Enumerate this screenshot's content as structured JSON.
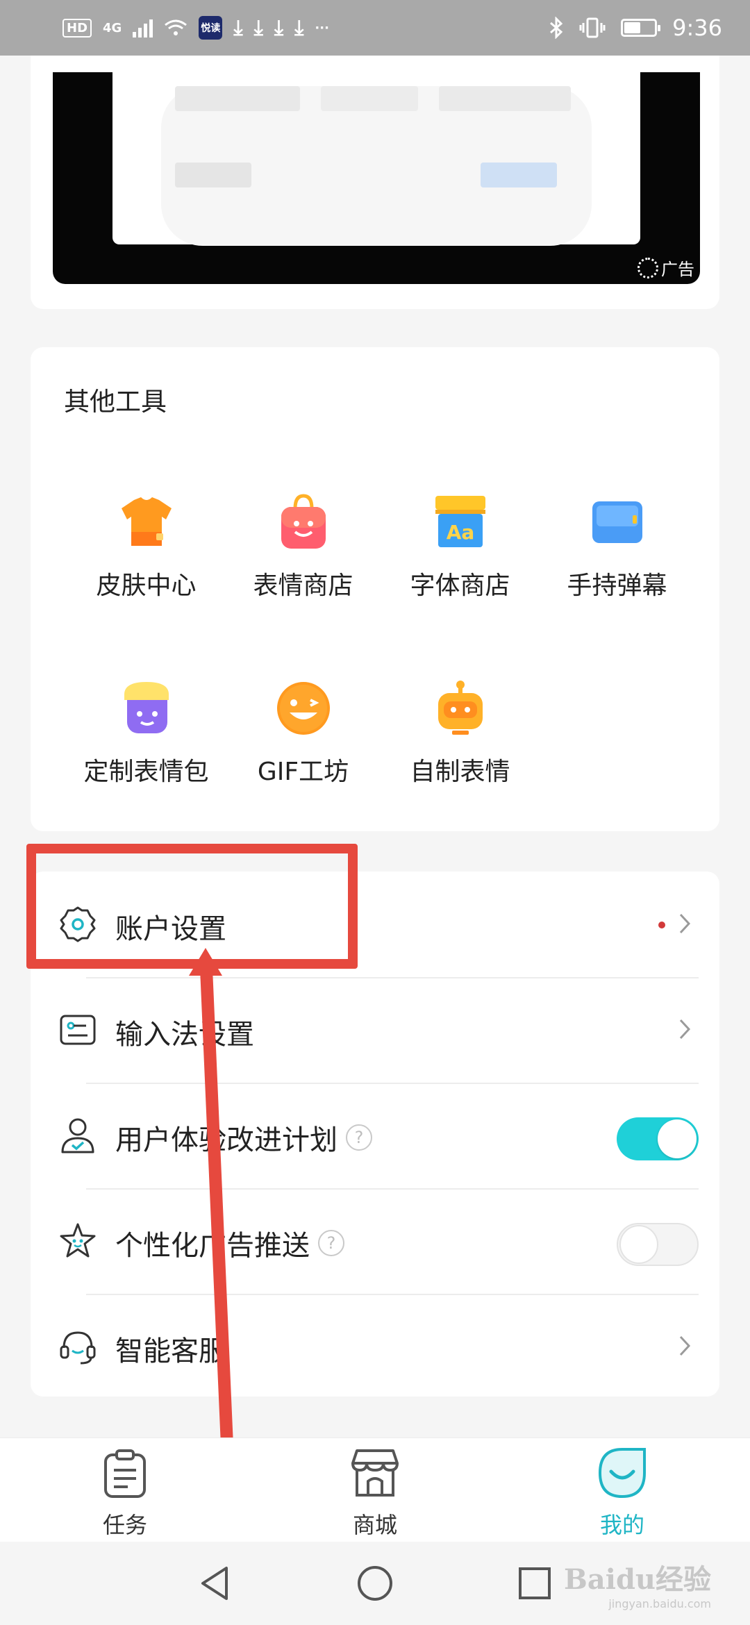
{
  "status_bar": {
    "hd": "HD",
    "network": "4G",
    "app_badge": "悦读",
    "time": "9:36",
    "battery_level": 0.55
  },
  "ad": {
    "label": "广告"
  },
  "tools": {
    "title": "其他工具",
    "items": [
      {
        "label": "皮肤中心",
        "icon": "shirt-icon"
      },
      {
        "label": "表情商店",
        "icon": "shopping-bag-icon"
      },
      {
        "label": "字体商店",
        "icon": "font-store-icon"
      },
      {
        "label": "手持弹幕",
        "icon": "handheld-banner-icon"
      },
      {
        "label": "定制表情包",
        "icon": "custom-emoji-icon"
      },
      {
        "label": "GIF工坊",
        "icon": "wink-face-icon"
      },
      {
        "label": "自制表情",
        "icon": "robot-icon"
      }
    ]
  },
  "settings": {
    "items": [
      {
        "label": "账户设置",
        "icon": "gear-icon",
        "has_dot": true
      },
      {
        "label": "输入法设置",
        "icon": "keyboard-settings-icon"
      },
      {
        "label": "用户体验改进计划",
        "icon": "user-check-icon",
        "help": "?",
        "toggle": true
      },
      {
        "label": "个性化广告推送",
        "icon": "star-face-icon",
        "help": "?",
        "toggle": false
      },
      {
        "label": "智能客服",
        "icon": "headset-icon"
      }
    ]
  },
  "bottom_nav": {
    "items": [
      {
        "label": "任务",
        "icon": "clipboard-icon",
        "active": false
      },
      {
        "label": "商城",
        "icon": "store-icon",
        "active": false
      },
      {
        "label": "我的",
        "icon": "smile-drop-icon",
        "active": true
      }
    ]
  },
  "colors": {
    "accent": "#1fd0d8",
    "annotation": "#e6493e",
    "notice_dot": "#d23a3a"
  },
  "watermark": {
    "brand": "Baidu经验",
    "domain": "jingyan.baidu.com"
  }
}
